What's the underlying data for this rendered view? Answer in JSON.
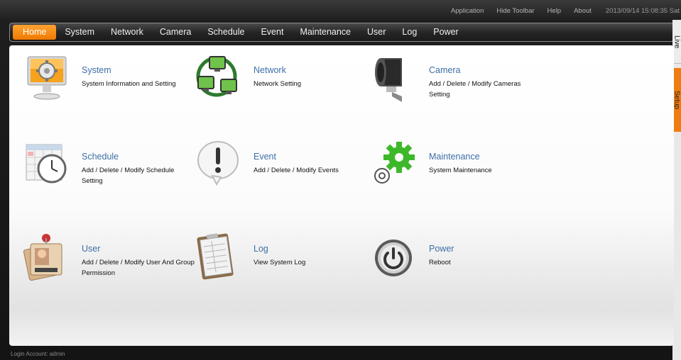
{
  "top_links": [
    "Application",
    "Hide Toolbar",
    "Help",
    "About"
  ],
  "datetime": "2013/09/14 15:08:35 Sat",
  "nav": [
    "Home",
    "System",
    "Network",
    "Camera",
    "Schedule",
    "Event",
    "Maintenance",
    "User",
    "Log",
    "Power"
  ],
  "active_nav": "Home",
  "side_tabs": {
    "live": "Live",
    "setup": "Setup"
  },
  "tiles": [
    {
      "title": "System",
      "desc": "System Information and Setting",
      "icon": "monitor-gear-icon"
    },
    {
      "title": "Network",
      "desc": "Network Setting",
      "icon": "network-computers-icon"
    },
    {
      "title": "Camera",
      "desc": "Add / Delete / Modify Cameras Setting",
      "icon": "security-camera-icon"
    },
    {
      "title": "Schedule",
      "desc": "Add / Delete / Modify Schedule Setting",
      "icon": "calendar-clock-icon"
    },
    {
      "title": "Event",
      "desc": "Add / Delete / Modify Events",
      "icon": "exclamation-bubble-icon"
    },
    {
      "title": "Maintenance",
      "desc": "System Maintenance",
      "icon": "gears-icon"
    },
    {
      "title": "User",
      "desc": "Add / Delete / Modify User And Group Permission",
      "icon": "id-cards-icon"
    },
    {
      "title": "Log",
      "desc": "View System Log",
      "icon": "clipboard-log-icon"
    },
    {
      "title": "Power",
      "desc": "Reboot",
      "icon": "power-button-icon"
    }
  ],
  "status": "Login Account: admin",
  "colors": {
    "accent": "#f07a00",
    "title_blue": "#3d6ea7"
  }
}
